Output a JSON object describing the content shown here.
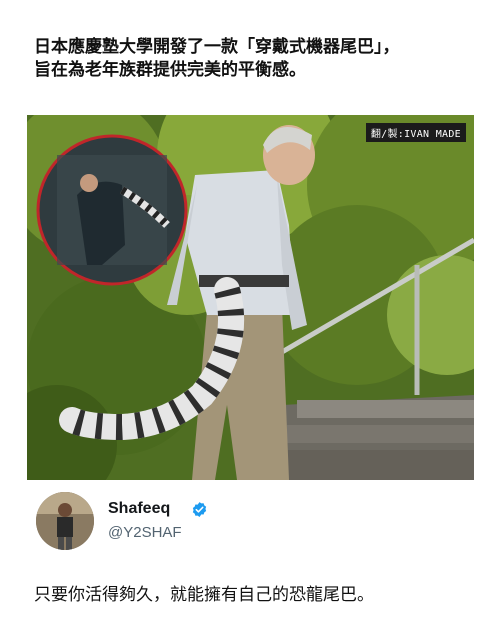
{
  "headline": {
    "line1": "日本應慶塾大學開發了一款「穿戴式機器尾巴」，",
    "line2": "旨在為老年族群提供完美的平衡感。"
  },
  "photo": {
    "credit": "翻/製:IVAN MADE"
  },
  "profile": {
    "name": "Shafeeq",
    "handle": "@Y2SHAF",
    "verified_icon": "verified-badge-icon",
    "verified_color": "#1d9bf0"
  },
  "post": {
    "text": "只要你活得夠久，就能擁有自己的恐龍尾巴。"
  }
}
